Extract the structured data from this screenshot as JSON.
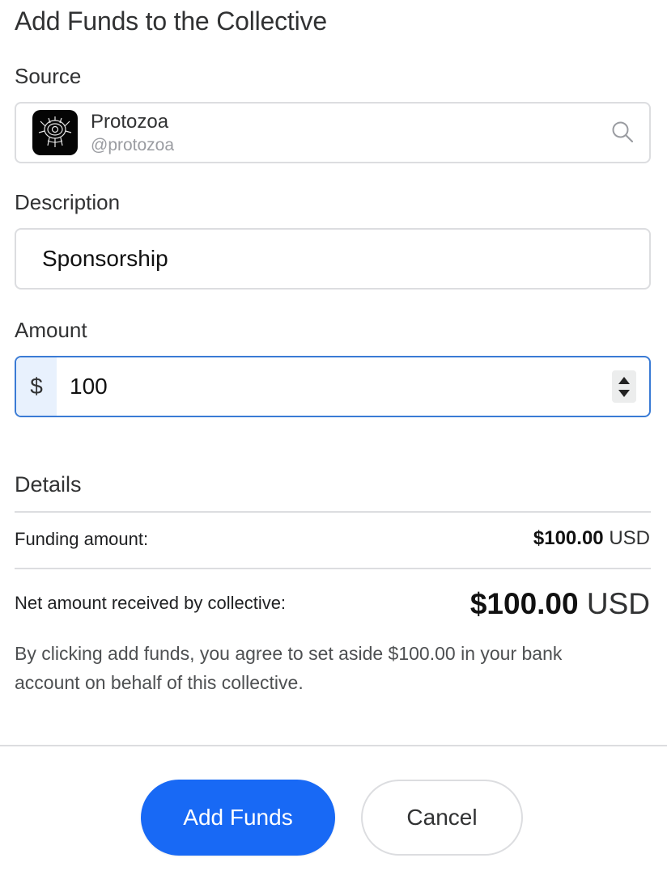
{
  "dialog": {
    "title": "Add Funds to the Collective"
  },
  "source": {
    "label": "Source",
    "account_name": "Protozoa",
    "account_handle": "@protozoa",
    "icon": "search-icon"
  },
  "description": {
    "label": "Description",
    "value": "Sponsorship"
  },
  "amount": {
    "label": "Amount",
    "currency_symbol": "$",
    "value": "100"
  },
  "details": {
    "heading": "Details",
    "funding_label": "Funding amount:",
    "funding_value": "$100.00",
    "funding_currency": "USD",
    "net_label": "Net amount received by collective:",
    "net_value": "$100.00",
    "net_currency": "USD",
    "notice": "By clicking add funds, you agree to set aside $100.00 in your bank account on behalf of this collective."
  },
  "actions": {
    "submit_label": "Add Funds",
    "cancel_label": "Cancel"
  },
  "colors": {
    "primary": "#1869f5",
    "focus_border": "#3a7bd5",
    "prefix_bg": "#e8f1fd"
  }
}
